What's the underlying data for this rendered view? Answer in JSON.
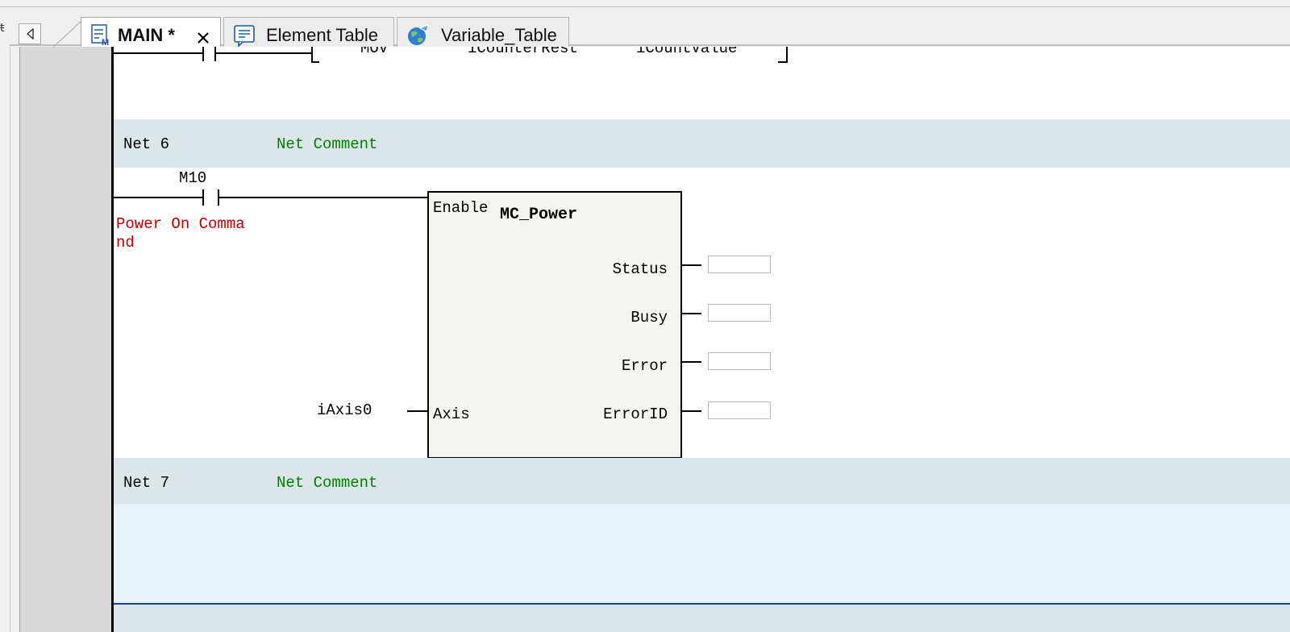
{
  "tabs": [
    {
      "label": "MAIN *",
      "icon": "ladder-program-icon",
      "active": true
    },
    {
      "label": "Element Table",
      "icon": "comment-table-icon"
    },
    {
      "label": "Variable_Table",
      "icon": "variable-globe-icon"
    }
  ],
  "top_fragment": {
    "instr": "MOV",
    "operand1": "iCounterRest",
    "operand2": "iCountValue"
  },
  "networks": [
    {
      "label": "Net 6",
      "comment": "Net Comment",
      "contact": {
        "address": "M10",
        "comment_line1": "Power On Comma",
        "comment_line2": "nd"
      },
      "fb": {
        "name": "MC_Power",
        "input_enable": "Enable",
        "input_axis": "Axis",
        "axis_variable": "iAxis0",
        "outputs": [
          "Status",
          "Busy",
          "Error",
          "ErrorID"
        ]
      }
    },
    {
      "label": "Net 7",
      "comment": "Net Comment"
    }
  ],
  "colors": {
    "comment_green": "#008000",
    "comment_red": "#c00000",
    "net_header": "#dce6e8",
    "selection": "#e6f3fb",
    "selection_border": "#1f3fb8"
  }
}
